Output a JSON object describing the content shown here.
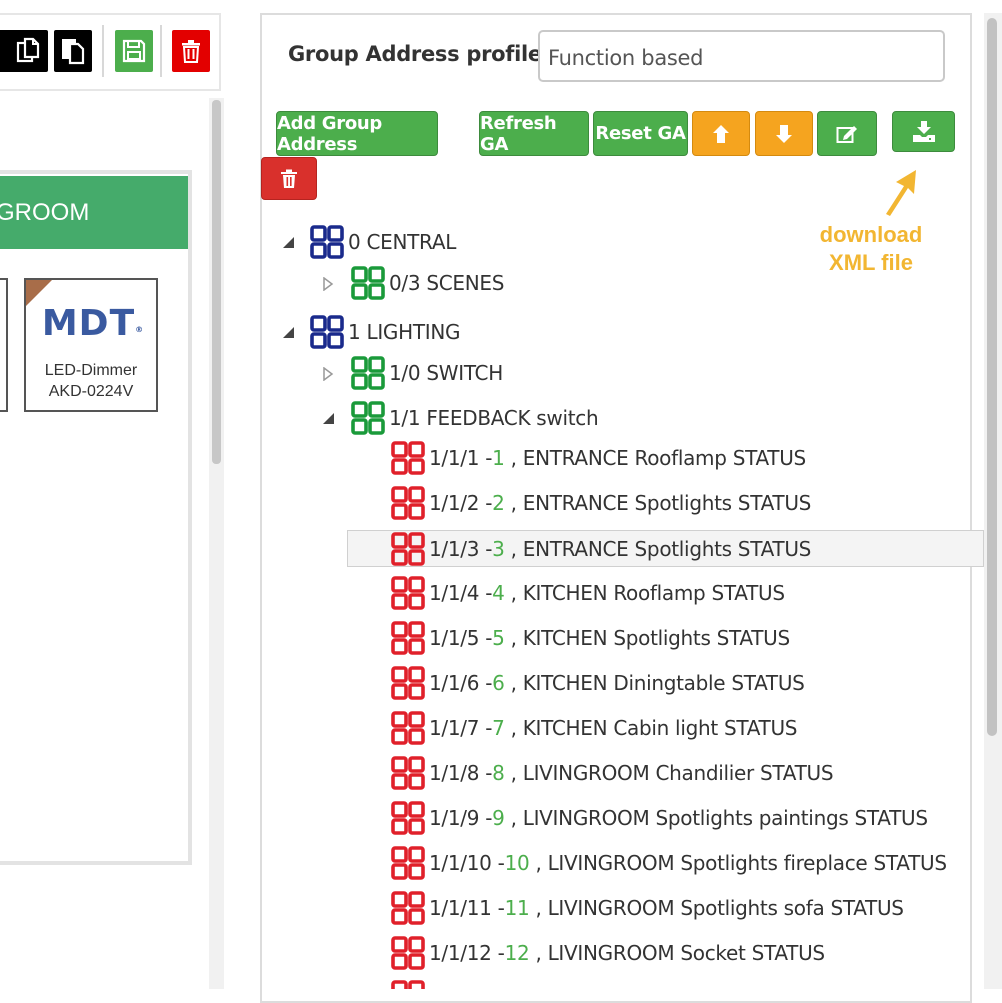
{
  "left": {
    "room_header": "GROOM",
    "device": {
      "logo": "MDT",
      "logo_mark": "®",
      "name_line1": "LED-Dimmer",
      "name_line2": "AKD-0224V"
    }
  },
  "right": {
    "profile_label": "Group Address profile :",
    "profile_value": "Function based",
    "buttons": {
      "add_group_address": "Add Group Address",
      "refresh_ga": "Refresh GA",
      "reset_ga": "Reset GA"
    },
    "annotation_line1": "download",
    "annotation_line2": "XML file",
    "tree": [
      {
        "text": "0 CENTRAL",
        "level": 0,
        "color": "blue",
        "expanded": true
      },
      {
        "text": "0/3 SCENES",
        "level": 1,
        "color": "green",
        "expanded": false
      },
      {
        "text": "1 LIGHTING",
        "level": 0,
        "color": "blue",
        "expanded": true
      },
      {
        "text": "1/0 SWITCH",
        "level": 1,
        "color": "green",
        "expanded": false
      },
      {
        "text": "1/1 FEEDBACK switch",
        "level": 1,
        "color": "green",
        "expanded": true
      },
      {
        "addr": "1/1/1 -",
        "num": "1",
        "label": " , ENTRANCE Rooflamp STATUS"
      },
      {
        "addr": "1/1/2 -",
        "num": "2",
        "label": " , ENTRANCE Spotlights STATUS"
      },
      {
        "addr": "1/1/3 -",
        "num": "3",
        "label": " , ENTRANCE Spotlights STATUS",
        "selected": true
      },
      {
        "addr": "1/1/4 -",
        "num": "4",
        "label": " , KITCHEN Rooflamp STATUS"
      },
      {
        "addr": "1/1/5 -",
        "num": "5",
        "label": " , KITCHEN Spotlights STATUS"
      },
      {
        "addr": "1/1/6 -",
        "num": "6",
        "label": " , KITCHEN Diningtable STATUS"
      },
      {
        "addr": "1/1/7 -",
        "num": "7",
        "label": " , KITCHEN Cabin light STATUS"
      },
      {
        "addr": "1/1/8 -",
        "num": "8",
        "label": " , LIVINGROOM Chandilier STATUS"
      },
      {
        "addr": "1/1/9 -",
        "num": "9",
        "label": " , LIVINGROOM Spotlights paintings STATUS"
      },
      {
        "addr": "1/1/10 -",
        "num": "10",
        "label": " , LIVINGROOM Spotlights fireplace STATUS"
      },
      {
        "addr": "1/1/11 -",
        "num": "11",
        "label": " , LIVINGROOM Spotlights sofa STATUS"
      },
      {
        "addr": "1/1/12 -",
        "num": "12",
        "label": " , LIVINGROOM Socket STATUS"
      }
    ]
  },
  "colors": {
    "green": "#4cae4c",
    "orange": "#f5a41f",
    "red": "#d9302c",
    "ga_blue": "#1a2a8c",
    "ga_green": "#1a9a3a",
    "ga_red": "#e0202a",
    "annotation": "#f2b632"
  }
}
